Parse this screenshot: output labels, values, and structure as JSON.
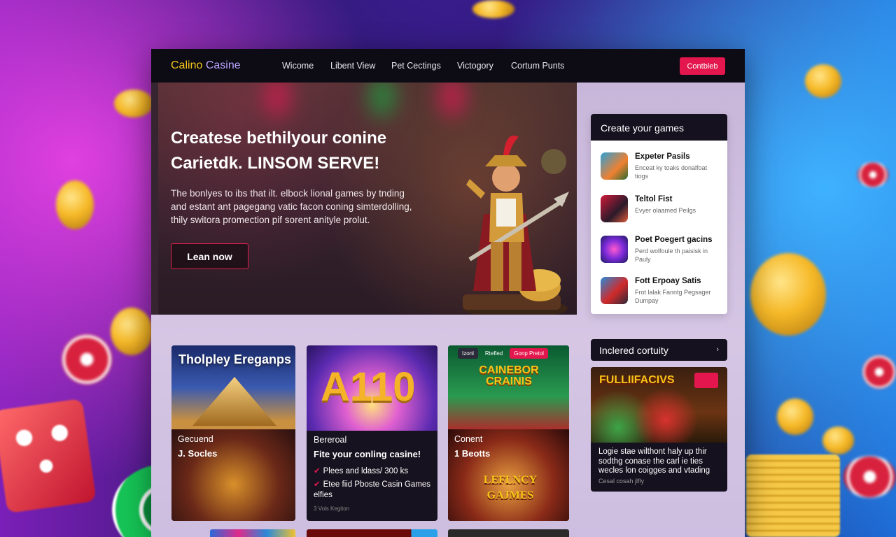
{
  "brand": {
    "part1": "Calino",
    "part2": "Casine"
  },
  "nav": {
    "items": [
      "Wicome",
      "Libent View",
      "Pet Cectings",
      "Victogory",
      "Cortum Punts"
    ]
  },
  "top_button": {
    "label": "Contbleb"
  },
  "hero": {
    "headline_line1": "Createse bethilyour conine",
    "headline_line2": "Carietdk. LINSOM SERVE!",
    "body": "The bonlyes to ibs that ilt. elbock lional games by tnding and estant ant pagegang vatic facon coning simterdolling, thily switora promection pif sorent anityle prolut.",
    "cta_label": "Lean now"
  },
  "side_panel": {
    "title": "Create your games",
    "items": [
      {
        "title": "Expeter Pasils",
        "desc": "Enceat ky toaks donalfoat tiogs"
      },
      {
        "title": "Teltol Fist",
        "desc": "Evyer olaamed Peilgs"
      },
      {
        "title": "Poet Poegert gacins",
        "desc": "Perd wolfoule th paisisk in Pauly"
      },
      {
        "title": "Fott Erpoay Satis",
        "desc": "Frot lalak Fanntg Pegsager Dumpay"
      }
    ]
  },
  "cards": [
    {
      "art_title": "Tholpley Ereganps",
      "label_small": "Gecuend",
      "label_large": "J. Socles"
    },
    {
      "art_title": "A110",
      "label_small": "Bereroal",
      "headline": "Fite your conling casine!",
      "bullets": [
        "Plees and ldass/ 300 ks",
        "Etee fiid Pboste Casin Games elfies"
      ],
      "footer": "3 Vols Kegiton"
    },
    {
      "top_tabs": [
        "Izonl",
        "Rtefled",
        "Gonp Pretol"
      ],
      "art_title": "CAINEBOR CRAINIS",
      "label_small": "Conent",
      "label_large": "1 Beotts",
      "art2_title": "LEFLNCY GAJMES"
    }
  ],
  "included": {
    "title": "Inclered cortuity",
    "art_title": "FULLIIFACIVS",
    "text": "Logie stae wilthont haly up thir sodthg conase the carl ie ties wecles lon coigges and vtading",
    "meta": "Cesal cosah jlfly"
  },
  "colors": {
    "accent": "#e3174e",
    "brand_gold": "#f5c518",
    "dark": "#15111f"
  }
}
